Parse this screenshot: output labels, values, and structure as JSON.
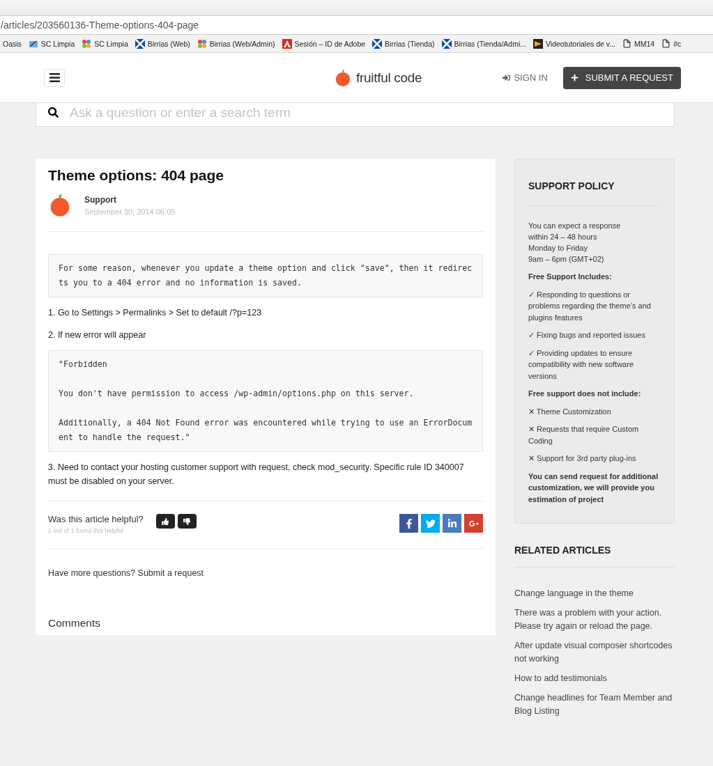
{
  "browser": {
    "url": "/articles/203560136-Theme-options-404-page",
    "bookmarks": [
      {
        "label": "Oasis",
        "kind": "none"
      },
      {
        "label": "SC Limpia",
        "kind": "pencil"
      },
      {
        "label": "SC Limpia",
        "kind": "joomla"
      },
      {
        "label": "Birrias (Web)",
        "kind": "flag"
      },
      {
        "label": "Birrias (Web/Admin)",
        "kind": "joomla"
      },
      {
        "label": "Sesión – ID de Adobe",
        "kind": "adobe"
      },
      {
        "label": "Birrias (Tienda)",
        "kind": "flag"
      },
      {
        "label": "Birrias (Tienda/Admi...",
        "kind": "flag"
      },
      {
        "label": "Videotutoriales de v...",
        "kind": "video"
      },
      {
        "label": "MM14",
        "kind": "page"
      },
      {
        "label": "#c",
        "kind": "page"
      }
    ]
  },
  "header": {
    "logo": "fruitful code",
    "sign_in": "SIGN IN",
    "submit": "SUBMIT A REQUEST"
  },
  "search": {
    "placeholder": "Ask a question or enter a search term"
  },
  "article": {
    "title": "Theme options: 404 page",
    "author": "Support",
    "date": "September 30, 2014 06:05",
    "body": [
      {
        "kind": "code",
        "paragraphs": [
          "For some reason, whenever you update a theme option and click \"save\", then it redirects you to a 404 error and no information is saved."
        ]
      },
      {
        "kind": "text",
        "text": "1. Go to Settings > Permalinks > Set to default /?p=123"
      },
      {
        "kind": "text",
        "text": "2. If new error will appear"
      },
      {
        "kind": "code",
        "paragraphs": [
          "\"Forbidden",
          "You don't have permission to access /wp-admin/options.php on this server.",
          "Additionally, a 404 Not Found error was encountered while trying to use an ErrorDocument to handle the request.\""
        ]
      },
      {
        "kind": "text",
        "text": "3. Need to contact your hosting customer support with request, check mod_security. Specific rule ID 340007 must be disabled on your server."
      }
    ],
    "helpful_question": "Was this article helpful?",
    "helpful_count": "1 out of 1 found this helpful",
    "share": [
      {
        "kind": "facebook",
        "color": "#3b5998"
      },
      {
        "kind": "twitter",
        "color": "#00aced"
      },
      {
        "kind": "linkedin",
        "color": "#4a7bbd"
      },
      {
        "kind": "googleplus",
        "color": "#d2402f"
      }
    ],
    "more_questions": "Have more questions?",
    "submit_link": "Submit a request",
    "comments": "Comments"
  },
  "policy": {
    "title": "SUPPORT POLICY",
    "intro": [
      "You can expect a response",
      "within 24 – 48 hours",
      "Monday to Friday",
      "9am – 6pm (GMT+02)"
    ],
    "includes_heading": "Free Support Includes:",
    "includes": [
      {
        "mark": "✓",
        "text": "Responding to questions or problems regarding the theme’s and plugins features"
      },
      {
        "mark": "✓",
        "text": "Fixing bugs and reported issues"
      },
      {
        "mark": "✓",
        "text": "Providing updates to ensure compatibility with new software versions"
      }
    ],
    "excludes_heading": "Free support does not include:",
    "excludes": [
      {
        "mark": "✕",
        "text": "Theme Customization"
      },
      {
        "mark": "✕",
        "text": "Requests that require Custom Coding"
      },
      {
        "mark": "✕",
        "text": "Support for 3rd party plug-ins"
      }
    ],
    "footer": "You can send request for additional customization, we will provide you estimation of project"
  },
  "related": {
    "title": "RELATED ARTICLES",
    "items": [
      "Change language in the theme",
      "There was a problem with your action. Please try again or reload the page.",
      "After update visual composer shortcodes not working",
      "How to add testimonials",
      "Change headlines for Team Member and Blog Listing"
    ]
  }
}
